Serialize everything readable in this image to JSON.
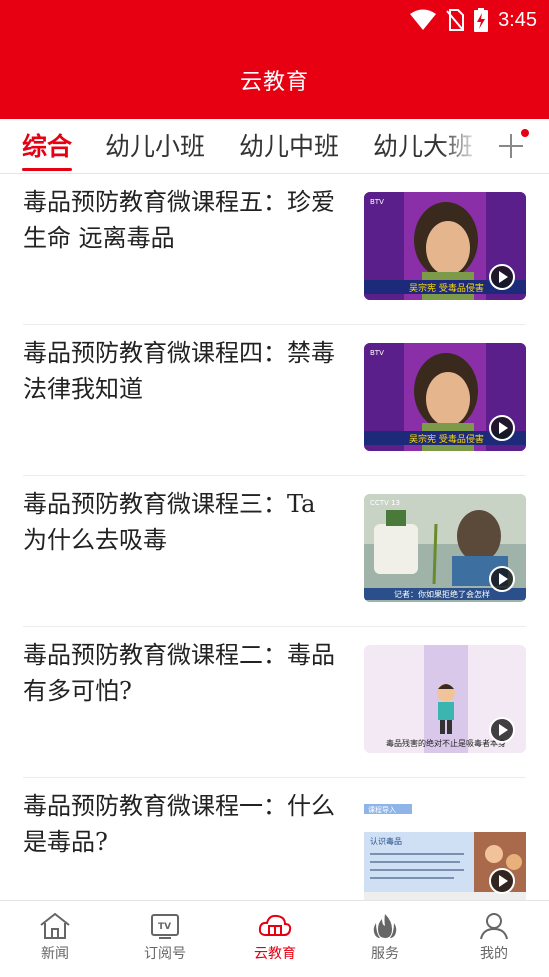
{
  "status_bar": {
    "time": "3:45"
  },
  "header": {
    "title": "云教育"
  },
  "tabs": [
    {
      "label": "综合",
      "active": true
    },
    {
      "label": "幼儿小班",
      "active": false
    },
    {
      "label": "幼儿中班",
      "active": false
    },
    {
      "label": "幼儿大班",
      "active": false
    }
  ],
  "articles": [
    {
      "title": "毒品预防教育微课程五：珍爱生命 远离毒品",
      "thumb_caption": "吴宗宪 受毒品侵害",
      "thumb_channel": "BTV"
    },
    {
      "title": "毒品预防教育微课程四：禁毒法律我知道",
      "thumb_caption": "吴宗宪 受毒品侵害",
      "thumb_channel": "BTV"
    },
    {
      "title": "毒品预防教育微课程三：Ta为什么去吸毒",
      "thumb_caption": "记者：你如果拒绝了会怎样",
      "thumb_channel": "CCTV 13"
    },
    {
      "title": "毒品预防教育微课程二：毒品有多可怕?",
      "thumb_caption": "毒品残害的绝对不止是吸毒者本身",
      "thumb_channel": ""
    },
    {
      "title": "毒品预防教育微课程一：什么是毒品?",
      "thumb_caption": "认识毒品",
      "thumb_channel": "课程导入"
    }
  ],
  "bottom_nav": [
    {
      "label": "新闻",
      "icon": "home-icon",
      "active": false
    },
    {
      "label": "订阅号",
      "icon": "tv-icon",
      "active": false
    },
    {
      "label": "云教育",
      "icon": "cloud-education-icon",
      "active": true
    },
    {
      "label": "服务",
      "icon": "service-icon",
      "active": false
    },
    {
      "label": "我的",
      "icon": "user-icon",
      "active": false
    }
  ],
  "colors": {
    "brand_red": "#e60012",
    "inactive_gray": "#666666"
  }
}
